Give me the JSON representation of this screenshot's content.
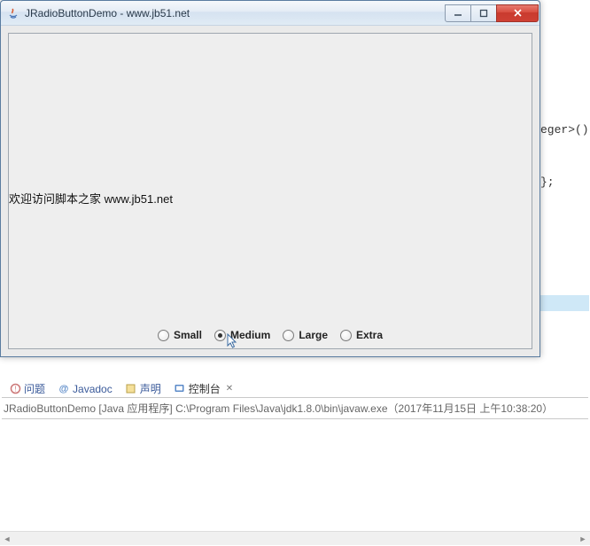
{
  "window": {
    "title": "JRadioButtonDemo - www.jb51.net",
    "content_text": "欢迎访问脚本之家 www.jb51.net",
    "radios": [
      {
        "label": "Small",
        "selected": false
      },
      {
        "label": "Medium",
        "selected": true
      },
      {
        "label": "Large",
        "selected": false
      },
      {
        "label": "Extra",
        "selected": false
      }
    ]
  },
  "bg_code": {
    "frag1": "eger>();",
    "frag2": "};"
  },
  "ide": {
    "tabs": [
      {
        "icon": "problems-icon",
        "label": "问题"
      },
      {
        "icon": "javadoc-icon",
        "label": "Javadoc"
      },
      {
        "icon": "declaration-icon",
        "label": "声明"
      },
      {
        "icon": "console-icon",
        "label": "控制台",
        "active": true,
        "closable": true
      }
    ],
    "console_text": "JRadioButtonDemo [Java 应用程序] C:\\Program Files\\Java\\jdk1.8.0\\bin\\javaw.exe（2017年11月15日 上午10:38:20）"
  }
}
